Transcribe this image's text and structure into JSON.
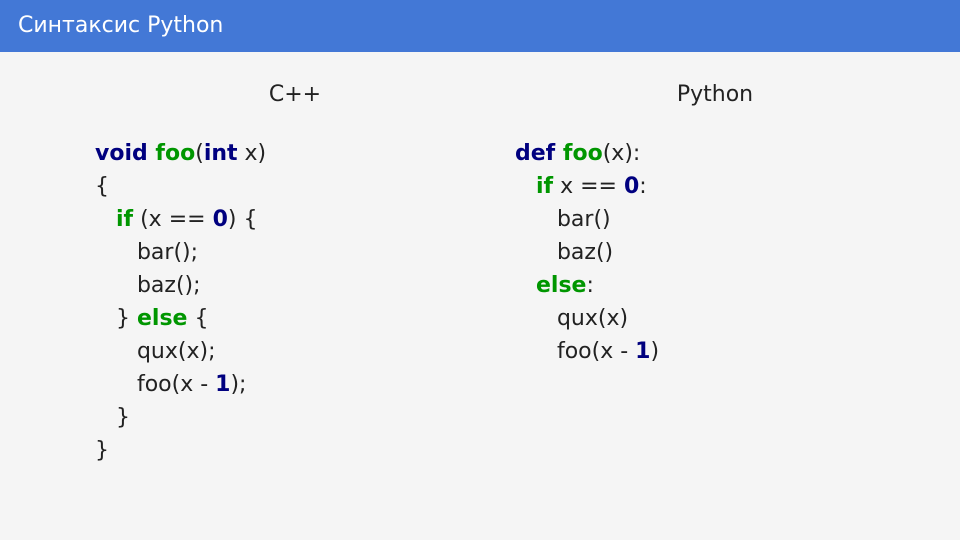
{
  "header": {
    "title": "Синтаксис Python"
  },
  "left": {
    "label": "C++",
    "code": [
      [
        {
          "t": "void ",
          "c": "kw"
        },
        {
          "t": "foo",
          "c": "fn"
        },
        {
          "t": "("
        },
        {
          "t": "int",
          "c": "kw"
        },
        {
          "t": " x)"
        }
      ],
      [
        {
          "t": "{"
        }
      ],
      [
        {
          "t": "   "
        },
        {
          "t": "if",
          "c": "ctrl"
        },
        {
          "t": " (x == "
        },
        {
          "t": "0",
          "c": "lit"
        },
        {
          "t": ") {"
        }
      ],
      [
        {
          "t": "      bar();"
        }
      ],
      [
        {
          "t": "      baz();"
        }
      ],
      [
        {
          "t": "   } "
        },
        {
          "t": "else",
          "c": "ctrl"
        },
        {
          "t": " {"
        }
      ],
      [
        {
          "t": "      qux(x);"
        }
      ],
      [
        {
          "t": "      foo(x - "
        },
        {
          "t": "1",
          "c": "lit"
        },
        {
          "t": ");"
        }
      ],
      [
        {
          "t": "   }"
        }
      ],
      [
        {
          "t": "}"
        }
      ]
    ]
  },
  "right": {
    "label": "Python",
    "code": [
      [
        {
          "t": "def ",
          "c": "kw"
        },
        {
          "t": "foo",
          "c": "fn"
        },
        {
          "t": "(x):"
        }
      ],
      [
        {
          "t": "   "
        },
        {
          "t": "if",
          "c": "ctrl"
        },
        {
          "t": " x == "
        },
        {
          "t": "0",
          "c": "lit"
        },
        {
          "t": ":"
        }
      ],
      [
        {
          "t": "      bar()"
        }
      ],
      [
        {
          "t": "      baz()"
        }
      ],
      [
        {
          "t": "   "
        },
        {
          "t": "else",
          "c": "ctrl"
        },
        {
          "t": ":"
        }
      ],
      [
        {
          "t": "      qux(x)"
        }
      ],
      [
        {
          "t": "      foo(x - "
        },
        {
          "t": "1",
          "c": "lit"
        },
        {
          "t": ")"
        }
      ]
    ]
  }
}
